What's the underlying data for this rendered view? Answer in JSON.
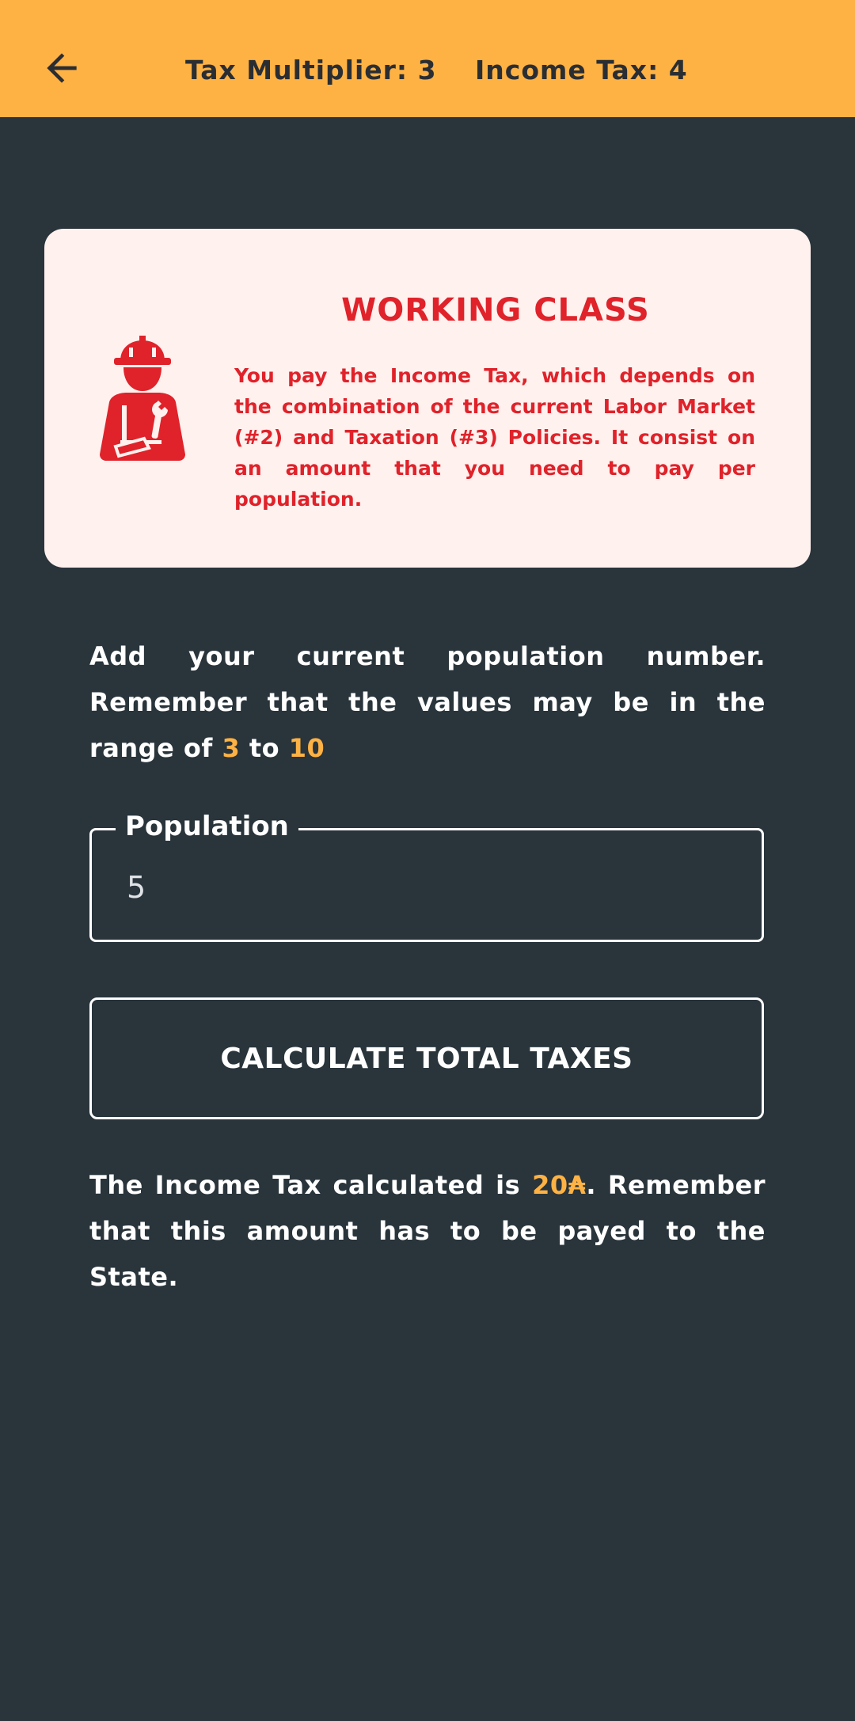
{
  "app_bar": {
    "back_icon": "arrow-left-icon",
    "tax_multiplier_label": "Tax Multiplier: 3",
    "income_tax_label": "Income Tax: 4"
  },
  "class_card": {
    "icon": "worker-icon",
    "title": "WORKING CLASS",
    "description": "You pay the Income Tax, which depends on the combination of the current Labor Market (#2) and Taxation (#3) Policies. It consist on an amount that you need to pay per population."
  },
  "instructions": {
    "text_before": "Add your current population number. Remember that the values may be in the range of ",
    "range_min": "3",
    "text_between": " to ",
    "range_max": "10"
  },
  "population_field": {
    "label": "Population",
    "value": "5"
  },
  "calculate_button": {
    "label": "CALCULATE TOTAL TAXES"
  },
  "result": {
    "text_before": "The Income Tax calculated is ",
    "amount": "20₳",
    "text_after": ". Remember that this amount has to be payed to the State."
  },
  "colors": {
    "app_bar": "#ffb244",
    "background": "#29343b",
    "card_background": "#fff1ee",
    "card_accent": "#e0222a",
    "highlight": "#ffb244",
    "text": "#ffffff"
  }
}
